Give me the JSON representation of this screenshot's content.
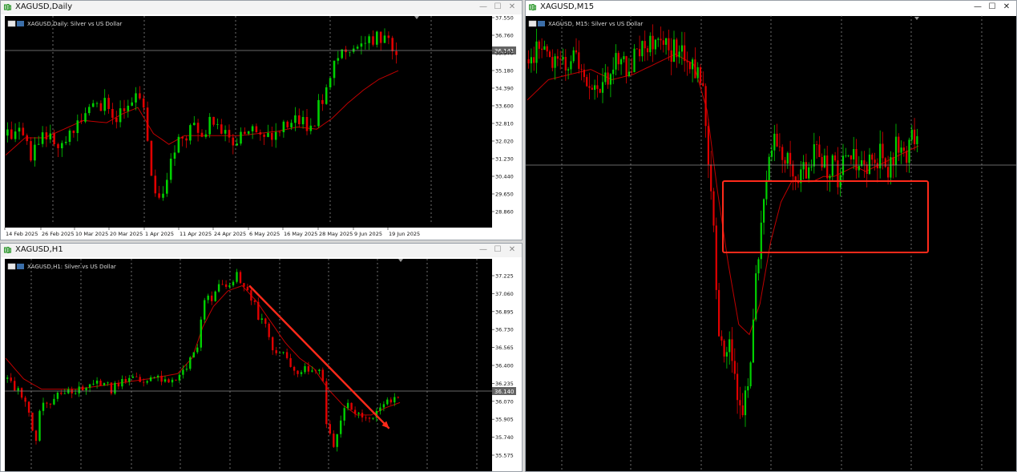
{
  "windows": [
    {
      "id": "daily",
      "title": "XAGUSD,Daily",
      "header": "XAGUSD,Daily:  Silver vs US Dollar",
      "controls": {
        "minimize": "—",
        "maximize": "☐",
        "close": "✕"
      },
      "current_price": "36.141",
      "price_labels": [
        "37.550",
        "36.760",
        "35.970",
        "35.180",
        "34.390",
        "33.600",
        "32.810",
        "32.020",
        "31.230",
        "30.440",
        "29.650",
        "28.860"
      ],
      "date_labels": [
        "14 Feb 2025",
        "26 Feb 2025",
        "10 Mar 2025",
        "20 Mar 2025",
        "1 Apr 2025",
        "11 Apr 2025",
        "24 Apr 2025",
        "6 May 2025",
        "16 May 2025",
        "28 May 2025",
        "9 Jun 2025",
        "19 Jun 2025"
      ]
    },
    {
      "id": "h1",
      "title": "XAGUSD,H1",
      "header": "XAGUSD,H1:  Silver vs US Dollar",
      "controls": {
        "minimize": "—",
        "maximize": "☐",
        "close": "✕"
      },
      "current_price": "36.140",
      "price_labels": [
        "37.225",
        "37.060",
        "36.895",
        "36.730",
        "36.565",
        "36.400",
        "36.235",
        "36.070",
        "35.905",
        "35.740",
        "35.575"
      ]
    },
    {
      "id": "m15",
      "title": "XAGUSD,M15",
      "header": "XAGUSD, M15:  Silver vs US Dollar",
      "controls": {
        "minimize": "—",
        "maximize": "☐",
        "close": "✕"
      }
    }
  ],
  "colors": {
    "bull": "#00d000",
    "bear": "#e00000",
    "ma": "#c00000",
    "annotation": "#ff2a1a",
    "grid": "#b8b8b8",
    "chart_bg": "#000000",
    "price_tag": "#646464"
  },
  "chart_data": [
    {
      "type": "candlestick",
      "window": "XAGUSD,Daily",
      "ylim": [
        28.5,
        37.6
      ],
      "x": [
        "14 Feb 2025",
        "26 Feb 2025",
        "10 Mar 2025",
        "20 Mar 2025",
        "1 Apr 2025",
        "11 Apr 2025",
        "24 Apr 2025",
        "6 May 2025",
        "16 May 2025",
        "28 May 2025",
        "9 Jun 2025",
        "19 Jun 2025"
      ],
      "close_path": [
        [
          0,
          32.3
        ],
        [
          4,
          32.7
        ],
        [
          7,
          31.4
        ],
        [
          10,
          32.2
        ],
        [
          15,
          32.0
        ],
        [
          18,
          32.6
        ],
        [
          22,
          33.6
        ],
        [
          26,
          33.7
        ],
        [
          29,
          33.1
        ],
        [
          32,
          34.0
        ],
        [
          34,
          34.3
        ],
        [
          36,
          33.8
        ],
        [
          38,
          30.3
        ],
        [
          40,
          29.4
        ],
        [
          42,
          30.4
        ],
        [
          44,
          31.8
        ],
        [
          48,
          32.6
        ],
        [
          52,
          32.5
        ],
        [
          54,
          33.1
        ],
        [
          57,
          32.3
        ],
        [
          60,
          32.1
        ],
        [
          63,
          32.5
        ],
        [
          66,
          32.4
        ],
        [
          70,
          32.3
        ],
        [
          74,
          33.1
        ],
        [
          78,
          32.8
        ],
        [
          80,
          33.1
        ],
        [
          82,
          34.1
        ],
        [
          84,
          35.2
        ],
        [
          87,
          36.2
        ],
        [
          90,
          36.0
        ],
        [
          93,
          36.5
        ],
        [
          96,
          36.9
        ],
        [
          99,
          36.6
        ],
        [
          101,
          36.2
        ]
      ],
      "ma_path": [
        [
          0,
          31.4
        ],
        [
          5,
          32.2
        ],
        [
          10,
          32.2
        ],
        [
          15,
          32.6
        ],
        [
          20,
          33.0
        ],
        [
          26,
          32.9
        ],
        [
          30,
          33.3
        ],
        [
          34,
          33.6
        ],
        [
          38,
          32.4
        ],
        [
          42,
          31.9
        ],
        [
          46,
          32.3
        ],
        [
          50,
          32.3
        ],
        [
          55,
          32.3
        ],
        [
          60,
          32.3
        ],
        [
          65,
          32.4
        ],
        [
          70,
          32.5
        ],
        [
          75,
          32.7
        ],
        [
          80,
          32.6
        ],
        [
          84,
          33.1
        ],
        [
          88,
          33.8
        ],
        [
          92,
          34.4
        ],
        [
          96,
          34.9
        ],
        [
          101,
          35.3
        ]
      ]
    },
    {
      "type": "candlestick",
      "window": "XAGUSD,H1",
      "ylim": [
        35.5,
        37.32
      ],
      "close_path": [
        [
          0,
          36.3
        ],
        [
          4,
          36.2
        ],
        [
          6,
          36.1
        ],
        [
          9,
          35.7
        ],
        [
          10,
          36.0
        ],
        [
          14,
          36.1
        ],
        [
          18,
          36.2
        ],
        [
          22,
          36.2
        ],
        [
          26,
          36.3
        ],
        [
          30,
          36.2
        ],
        [
          34,
          36.3
        ],
        [
          38,
          36.3
        ],
        [
          42,
          36.3
        ],
        [
          46,
          36.3
        ],
        [
          50,
          36.35
        ],
        [
          54,
          36.6
        ],
        [
          56,
          37.1
        ],
        [
          58,
          37.05
        ],
        [
          60,
          37.2
        ],
        [
          62,
          37.15
        ],
        [
          64,
          37.25
        ],
        [
          65,
          37.3
        ],
        [
          67,
          37.2
        ],
        [
          69,
          37.1
        ],
        [
          71,
          36.9
        ],
        [
          73,
          36.8
        ],
        [
          75,
          36.55
        ],
        [
          78,
          36.55
        ],
        [
          81,
          36.35
        ],
        [
          84,
          36.4
        ],
        [
          87,
          36.4
        ],
        [
          89,
          36.3
        ],
        [
          90,
          35.9
        ],
        [
          92,
          35.65
        ],
        [
          94,
          35.9
        ],
        [
          96,
          36.05
        ],
        [
          99,
          35.95
        ],
        [
          102,
          35.9
        ],
        [
          105,
          36.05
        ],
        [
          108,
          36.1
        ],
        [
          110,
          36.12
        ]
      ],
      "ma_path": [
        [
          0,
          36.5
        ],
        [
          5,
          36.3
        ],
        [
          10,
          36.2
        ],
        [
          20,
          36.2
        ],
        [
          30,
          36.25
        ],
        [
          40,
          36.3
        ],
        [
          48,
          36.35
        ],
        [
          52,
          36.5
        ],
        [
          55,
          36.8
        ],
        [
          58,
          37.0
        ],
        [
          62,
          37.15
        ],
        [
          66,
          37.2
        ],
        [
          70,
          37.05
        ],
        [
          74,
          36.85
        ],
        [
          78,
          36.65
        ],
        [
          82,
          36.5
        ],
        [
          86,
          36.4
        ],
        [
          90,
          36.2
        ],
        [
          94,
          36.05
        ],
        [
          98,
          35.95
        ],
        [
          102,
          35.95
        ],
        [
          106,
          36.02
        ],
        [
          110,
          36.07
        ]
      ],
      "arrow": {
        "from": [
          68,
          37.2
        ],
        "to": [
          107,
          35.82
        ]
      }
    },
    {
      "type": "candlestick",
      "window": "XAGUSD,M15",
      "ylim": [
        35.5,
        37.32
      ],
      "close_path": [
        [
          0,
          37.0
        ],
        [
          6,
          37.15
        ],
        [
          12,
          36.9
        ],
        [
          18,
          37.05
        ],
        [
          22,
          36.8
        ],
        [
          28,
          36.6
        ],
        [
          33,
          37.0
        ],
        [
          38,
          36.9
        ],
        [
          44,
          37.1
        ],
        [
          50,
          37.2
        ],
        [
          54,
          37.05
        ],
        [
          58,
          37.1
        ],
        [
          63,
          37.0
        ],
        [
          67,
          36.7
        ],
        [
          69,
          36.0
        ],
        [
          71,
          35.3
        ],
        [
          73,
          34.3
        ],
        [
          75,
          34.2
        ],
        [
          77,
          34.2
        ],
        [
          79,
          34.0
        ],
        [
          80,
          33.6
        ],
        [
          82,
          33.5
        ],
        [
          84,
          33.8
        ],
        [
          86,
          34.5
        ],
        [
          88,
          35.1
        ],
        [
          90,
          35.7
        ],
        [
          92,
          36.1
        ],
        [
          94,
          36.3
        ],
        [
          96,
          36.2
        ],
        [
          98,
          35.9
        ],
        [
          100,
          36.05
        ],
        [
          102,
          35.8
        ],
        [
          104,
          35.9
        ],
        [
          106,
          35.85
        ],
        [
          108,
          36.05
        ],
        [
          110,
          36.1
        ],
        [
          112,
          36.0
        ],
        [
          114,
          35.95
        ],
        [
          116,
          36.0
        ],
        [
          118,
          35.8
        ],
        [
          120,
          36.1
        ],
        [
          122,
          36.0
        ],
        [
          124,
          36.1
        ],
        [
          126,
          35.95
        ],
        [
          128,
          35.95
        ],
        [
          130,
          36.0
        ],
        [
          132,
          36.0
        ],
        [
          134,
          36.1
        ],
        [
          136,
          35.9
        ],
        [
          138,
          36.0
        ],
        [
          140,
          36.15
        ],
        [
          142,
          36.1
        ],
        [
          144,
          36.1
        ],
        [
          146,
          36.2
        ],
        [
          148,
          36.3
        ]
      ],
      "ma_path": [
        [
          0,
          36.6
        ],
        [
          8,
          36.8
        ],
        [
          16,
          36.85
        ],
        [
          24,
          36.9
        ],
        [
          32,
          36.8
        ],
        [
          40,
          36.85
        ],
        [
          48,
          36.95
        ],
        [
          56,
          37.05
        ],
        [
          63,
          36.95
        ],
        [
          68,
          36.5
        ],
        [
          72,
          35.7
        ],
        [
          76,
          35.0
        ],
        [
          80,
          34.4
        ],
        [
          84,
          34.3
        ],
        [
          88,
          34.6
        ],
        [
          92,
          35.2
        ],
        [
          96,
          35.6
        ],
        [
          100,
          35.8
        ],
        [
          104,
          35.8
        ],
        [
          108,
          35.8
        ],
        [
          112,
          35.85
        ],
        [
          116,
          35.85
        ],
        [
          120,
          35.9
        ],
        [
          124,
          35.95
        ],
        [
          128,
          35.9
        ],
        [
          132,
          35.95
        ],
        [
          136,
          36.0
        ],
        [
          140,
          36.05
        ],
        [
          144,
          36.1
        ],
        [
          148,
          36.15
        ]
      ]
    }
  ]
}
